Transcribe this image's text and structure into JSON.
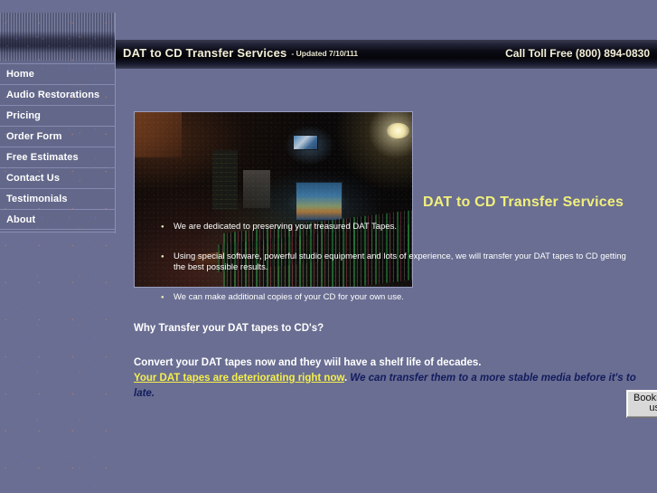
{
  "site": {
    "title": "DAT to CD Transfer Services"
  },
  "header": {
    "title": "DAT to CD Transfer Services",
    "updated": "- Updated 7/10/111",
    "phone": "Call Toll Free (800) 894-0830"
  },
  "sidebar": {
    "items": [
      {
        "label": "Home"
      },
      {
        "label": "Audio Restorations"
      },
      {
        "label": "Pricing"
      },
      {
        "label": "Order Form"
      },
      {
        "label": "Free Estimates"
      },
      {
        "label": "Contact Us"
      },
      {
        "label": "Testimonials"
      },
      {
        "label": "About"
      }
    ]
  },
  "main": {
    "hero_heading": "DAT to CD Transfer Services",
    "photo_alt": "recording-studio-mixing-console",
    "question_heading": "Why Transfer your DAT tapes to CD's?",
    "bookmark_label": "Bookmark us!",
    "lead_line": "Convert your DAT tapes now and they wiil have a shelf life of decades.",
    "deteriorating_link": "Your DAT tapes are deteriorating right now",
    "after_link_punct": ".",
    "italic_note": "We can transfer them to a more stable media before it's to late.",
    "bullets": [
      "We are dedicated to preserving your treasured DAT Tapes.",
      "Using special software, powerful studio equipment and lots of experience, we will transfer your DAT tapes to CD getting the best possible results.",
      "We can make additional copies of your CD for your own use."
    ]
  },
  "colors": {
    "page_background": "#6a6e92",
    "header_bar_dark": "#050509",
    "header_text": "#f4f0d8",
    "hero_heading": "#f2f07a",
    "link_yellow": "#f5ef4a",
    "italic_blue": "#121c5e",
    "sidebar_divider": "#868ab0",
    "bullet_marker": "#f0eec0"
  }
}
